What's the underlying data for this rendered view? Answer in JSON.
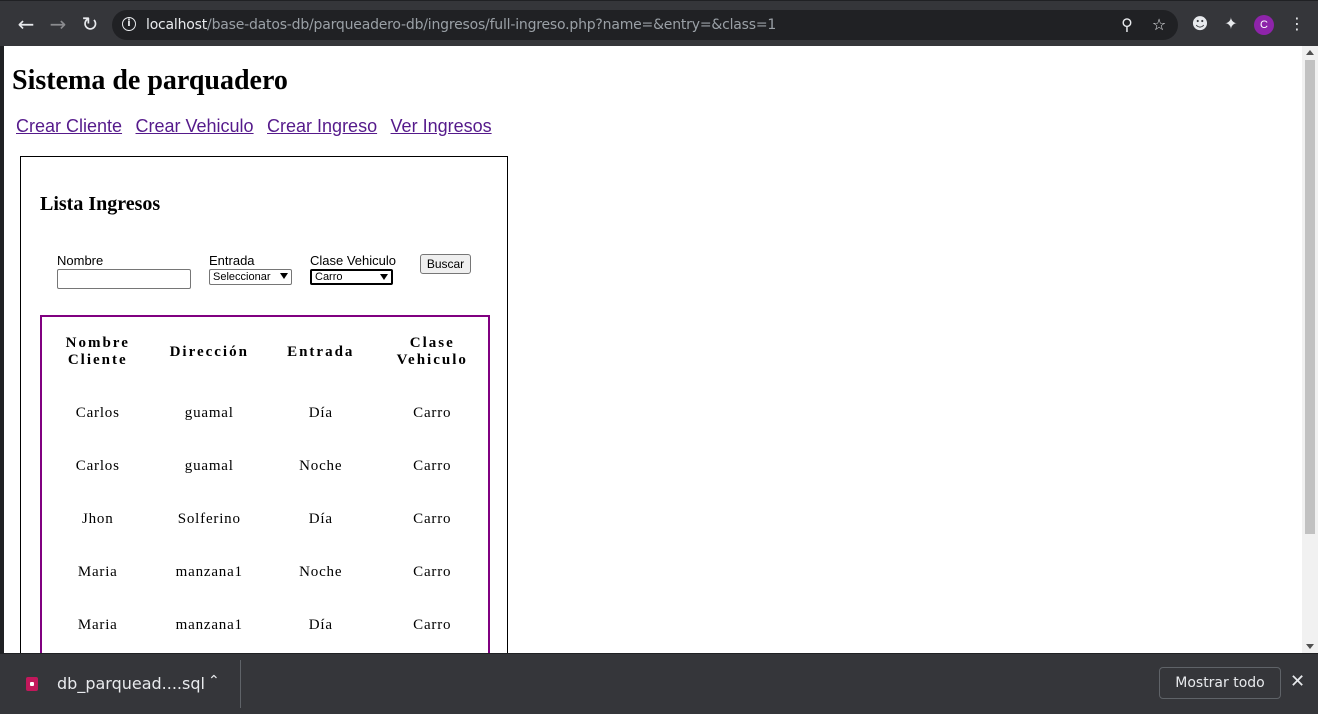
{
  "browser": {
    "url_host": "localhost",
    "url_path": "/base-datos-db/parqueadero-db/ingresos/full-ingreso.php?name=&entry=&class=1",
    "profile_initial": "C"
  },
  "page": {
    "title": "Sistema de parquadero",
    "nav": {
      "crear_cliente": "Crear Cliente",
      "crear_vehiculo": "Crear Vehiculo",
      "crear_ingreso": "Crear Ingreso",
      "ver_ingresos": "Ver Ingresos"
    },
    "card": {
      "title": "Lista Ingresos",
      "filters": {
        "nombre_label": "Nombre",
        "nombre_value": "",
        "entrada_label": "Entrada",
        "entrada_selected": "Seleccionar",
        "clase_label": "Clase Vehiculo",
        "clase_selected": "Carro",
        "buscar_label": "Buscar"
      },
      "table": {
        "headers": {
          "nombre_line1": "Nombre",
          "nombre_line2": "Cliente",
          "direccion": "Dirección",
          "entrada": "Entrada",
          "clase_line1": "Clase",
          "clase_line2": "Vehiculo"
        },
        "rows": [
          {
            "nombre": "Carlos",
            "direccion": "guamal",
            "entrada": "Día",
            "clase": "Carro"
          },
          {
            "nombre": "Carlos",
            "direccion": "guamal",
            "entrada": "Noche",
            "clase": "Carro"
          },
          {
            "nombre": "Jhon",
            "direccion": "Solferino",
            "entrada": "Día",
            "clase": "Carro"
          },
          {
            "nombre": "Maria",
            "direccion": "manzana1",
            "entrada": "Noche",
            "clase": "Carro"
          },
          {
            "nombre": "Maria",
            "direccion": "manzana1",
            "entrada": "Día",
            "clase": "Carro"
          }
        ]
      }
    }
  },
  "download_bar": {
    "file_name": "db_parquead....sql",
    "show_all_label": "Mostrar todo"
  },
  "icons": {
    "back": "back-arrow-icon",
    "forward": "forward-arrow-icon",
    "reload": "reload-icon",
    "site_info": "info-icon",
    "zoom": "zoom-icon",
    "bookmark": "star-icon",
    "extension_cat": "cat-extension-icon",
    "extensions": "puzzle-icon",
    "menu": "kebab-menu-icon"
  },
  "colors": {
    "link_visited": "#551a8b",
    "table_border": "#800080",
    "chrome_dark": "#35363a",
    "avatar": "#8e24aa"
  }
}
